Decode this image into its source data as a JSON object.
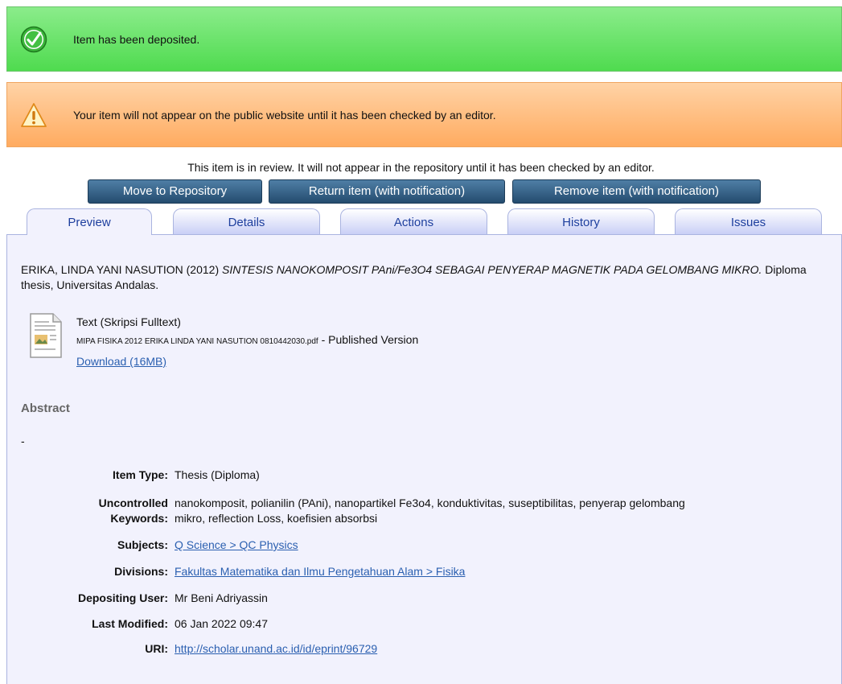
{
  "messages": {
    "success": "Item has been deposited.",
    "warning": "Your item will not appear on the public website until it has been checked by an editor."
  },
  "review_note": "This item is in review. It will not appear in the repository until it has been checked by an editor.",
  "actions": {
    "move": "Move to Repository",
    "return": "Return item (with notification)",
    "remove": "Remove item (with notification)"
  },
  "tabs": [
    "Preview",
    "Details",
    "Actions",
    "History",
    "Issues"
  ],
  "active_tab": "Preview",
  "citation": {
    "authors_year": "ERIKA, LINDA YANI NASUTION (2012)",
    "title": "SINTESIS NANOKOMPOSIT PAni/Fe3O4 SEBAGAI PENYERAP MAGNETIK PADA GELOMBANG MIKRO.",
    "rest": "Diploma thesis, Universitas Andalas."
  },
  "document": {
    "type": "Text (Skripsi Fulltext)",
    "filename": "MIPA FISIKA 2012 ERIKA LINDA YANI NASUTION 0810442030.pdf",
    "version": "- Published Version",
    "download": "Download (16MB)"
  },
  "abstract": {
    "heading": "Abstract",
    "text": "-"
  },
  "metadata": {
    "item_type_label": "Item Type:",
    "item_type": "Thesis (Diploma)",
    "keywords_label_1": "Uncontrolled",
    "keywords_label_2": "Keywords:",
    "keywords_line_1": "nanokomposit, polianilin (PAni), nanopartikel Fe3o4, konduktivitas, suseptibilitas, penyerap gelombang",
    "keywords_line_2": "mikro, reflection Loss, koefisien absorbsi",
    "subjects_label": "Subjects:",
    "subjects": "Q Science > QC Physics",
    "divisions_label": "Divisions:",
    "divisions": "Fakultas Matematika dan Ilmu Pengetahuan Alam > Fisika",
    "depositing_label": "Depositing User:",
    "depositing": "Mr Beni Adriyassin",
    "modified_label": "Last Modified:",
    "modified": "06 Jan 2022 09:47",
    "uri_label": "URI:",
    "uri": "http://scholar.unand.ac.id/id/eprint/96729"
  },
  "colors": {
    "success_bg": "#5fe05f",
    "warning_bg": "#ffb36e",
    "button_bg": "#2f5a80",
    "tab_text": "#1e3f9e",
    "link": "#2a5fb0",
    "panel_bg": "#f2f2fd"
  },
  "icons": {
    "success": "check-circle-icon",
    "warning": "warning-triangle-icon",
    "document": "document-icon"
  }
}
